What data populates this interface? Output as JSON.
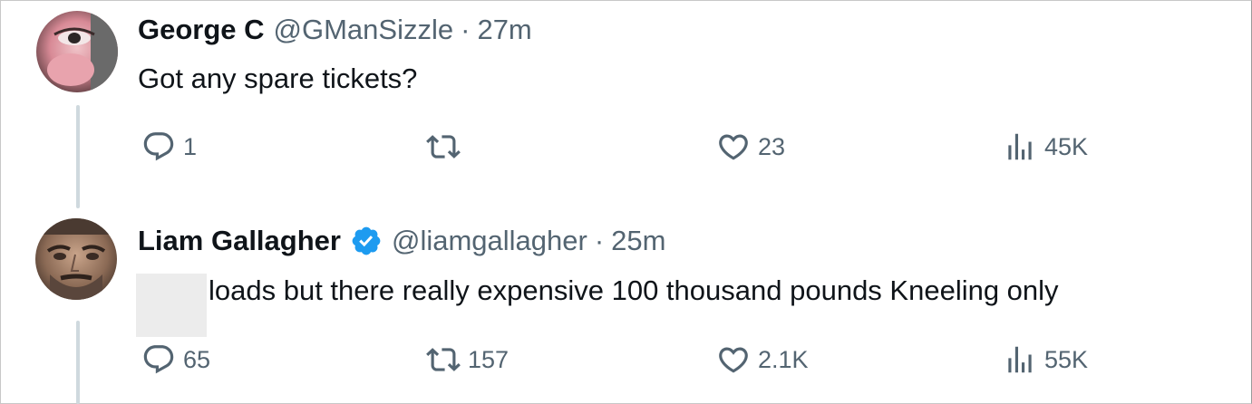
{
  "tweets": [
    {
      "name": "George C",
      "handle": "@GManSizzle",
      "separator": "·",
      "time": "27m",
      "text": "Got any spare tickets?",
      "verified": false,
      "metrics": {
        "replies": "1",
        "retweets": "",
        "likes": "23",
        "views": "45K"
      }
    },
    {
      "name": "Liam Gallagher",
      "handle": "@liamgallagher",
      "separator": "·",
      "time": "25m",
      "text": "loads but there really expensive 100 thousand pounds Kneeling only",
      "verified": true,
      "metrics": {
        "replies": "65",
        "retweets": "157",
        "likes": "2.1K",
        "views": "55K"
      }
    }
  ],
  "colors": {
    "text_primary": "#0f1419",
    "text_secondary": "#536471",
    "verified_blue": "#1d9bf0",
    "thread_line": "#cfd9de"
  },
  "icons": {
    "reply": "reply-icon",
    "retweet": "retweet-icon",
    "like": "heart-icon",
    "views": "views-icon",
    "verified": "verified-badge-icon"
  }
}
